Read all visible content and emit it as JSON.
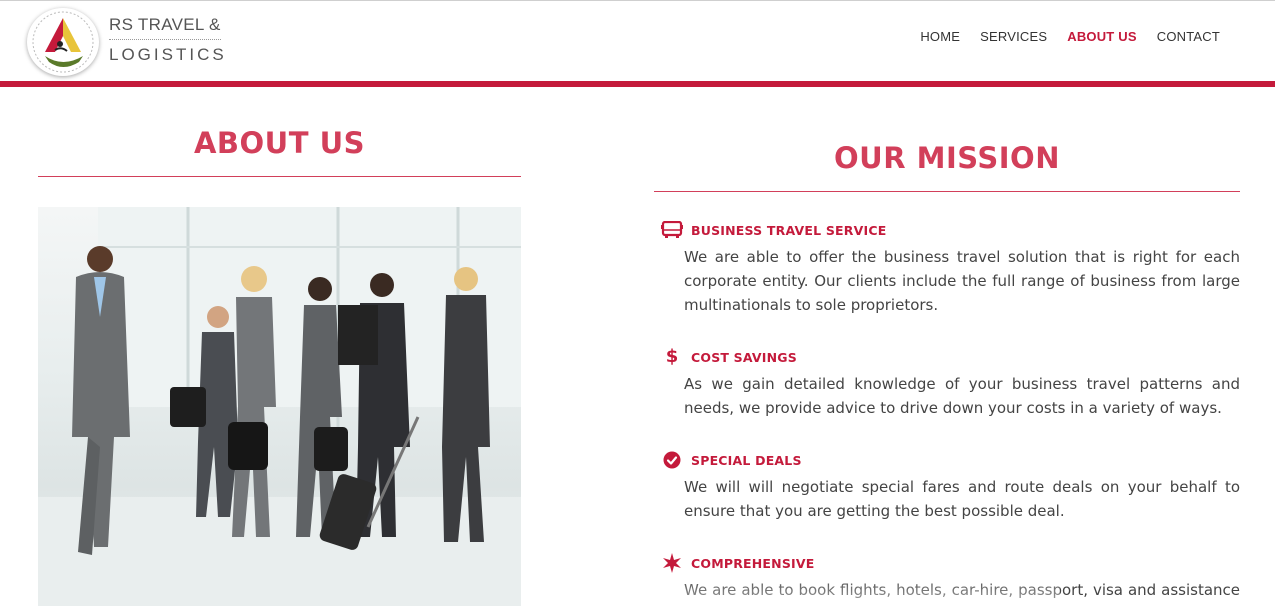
{
  "header": {
    "brand_line1": "RS TRAVEL &",
    "brand_line2": "LOGISTICS",
    "accent_color": "#c41a3b",
    "nav": [
      {
        "label": "HOME",
        "active": false
      },
      {
        "label": "SERVICES",
        "active": false
      },
      {
        "label": "ABOUT US",
        "active": true
      },
      {
        "label": "CONTACT",
        "active": false
      }
    ]
  },
  "about": {
    "title": "ABOUT US",
    "image_subject": "business travelers walking through an airport terminal with luggage"
  },
  "mission": {
    "title": "OUR MISSION",
    "items": [
      {
        "icon": "bus-icon",
        "title": "BUSINESS TRAVEL SERVICE",
        "text": "We are able to offer the business travel solution that is right for each corporate entity. Our clients include the full range of business from large multinationals to sole proprietors."
      },
      {
        "icon": "dollar-icon",
        "title": "COST SAVINGS",
        "text": "As we gain detailed knowledge of your business travel patterns and needs, we provide advice to drive down your costs in a variety of ways."
      },
      {
        "icon": "check-circle-icon",
        "title": "SPECIAL DEALS",
        "text": "We will will negotiate special fares and route deals on your behalf to ensure that you are getting the best possible deal."
      },
      {
        "icon": "star-burst-icon",
        "title": "COMPREHENSIVE",
        "text": "We are able to book flights, hotels, car-hire, passport, visa and assistance at"
      }
    ]
  }
}
